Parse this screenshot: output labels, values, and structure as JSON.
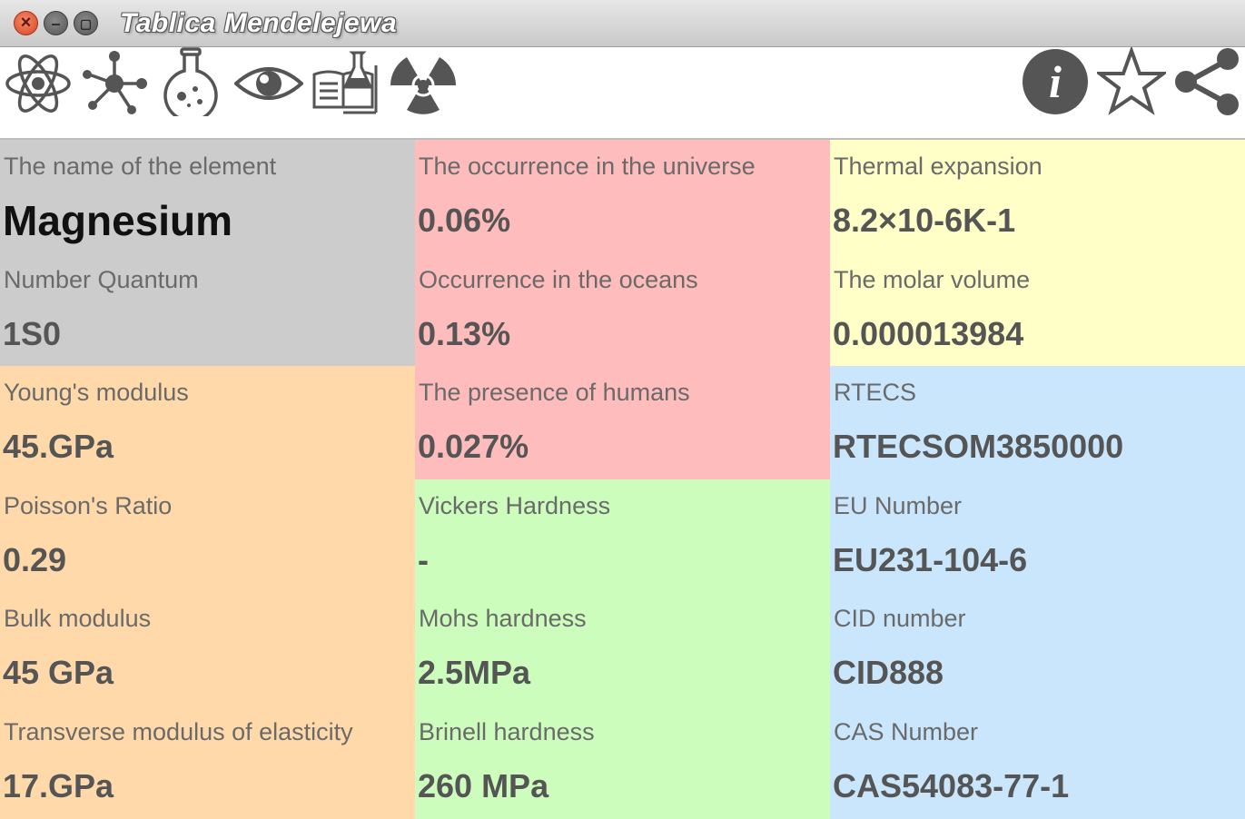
{
  "window": {
    "title": "Tablica Mendelejewa",
    "close_glyph": "×",
    "minimize_glyph": "–",
    "maximize_glyph": "▢"
  },
  "toolbar": {
    "left_icons": [
      "atom-icon",
      "molecule-icon",
      "flask-icon",
      "eye-icon",
      "book-flask-icon",
      "radiation-icon"
    ],
    "right_icons": [
      "info-icon",
      "star-icon",
      "share-icon"
    ],
    "info_glyph": "i"
  },
  "colors": {
    "gray": "#cccccc",
    "orange": "#ffd9aa",
    "pink": "#ffbcbc",
    "green": "#ccfdbd",
    "yellow": "#ffffc7",
    "blue": "#c9e6fc"
  },
  "columns": [
    {
      "cells": [
        {
          "label": "The name of the element",
          "value": "Magnesium",
          "color": "#cccccc"
        },
        {
          "label": "Number Quantum",
          "value": "1S0",
          "color": "#cccccc"
        },
        {
          "label": "Young's modulus",
          "value": "45.GPa",
          "color": "#ffd9aa"
        },
        {
          "label": "Poisson's Ratio",
          "value": "0.29",
          "color": "#ffd9aa"
        },
        {
          "label": "Bulk modulus",
          "value": "45 GPa",
          "color": "#ffd9aa"
        },
        {
          "label": "Transverse modulus of elasticity",
          "value": "17.GPa",
          "color": "#ffd9aa"
        }
      ]
    },
    {
      "cells": [
        {
          "label": "The occurrence in the universe",
          "value": "0.06%",
          "color": "#ffbcbc"
        },
        {
          "label": "Occurrence in the oceans",
          "value": "0.13%",
          "color": "#ffbcbc"
        },
        {
          "label": "The presence of humans",
          "value": "0.027%",
          "color": "#ffbcbc"
        },
        {
          "label": "Vickers Hardness",
          "value": "-",
          "color": "#ccfdbd"
        },
        {
          "label": "Mohs hardness",
          "value": "2.5MPa",
          "color": "#ccfdbd"
        },
        {
          "label": "Brinell hardness",
          "value": "260 MPa",
          "color": "#ccfdbd"
        }
      ]
    },
    {
      "cells": [
        {
          "label": "Thermal expansion",
          "value": "8.2×10-6K-1",
          "color": "#ffffc7"
        },
        {
          "label": "The molar volume",
          "value": "0.000013984",
          "color": "#ffffc7"
        },
        {
          "label": "RTECS",
          "value": "RTECSOM3850000",
          "color": "#c9e6fc"
        },
        {
          "label": "EU Number",
          "value": "EU231-104-6",
          "color": "#c9e6fc"
        },
        {
          "label": "CID number",
          "value": "CID888",
          "color": "#c9e6fc"
        },
        {
          "label": "CAS Number",
          "value": "CAS54083-77-1",
          "color": "#c9e6fc"
        }
      ]
    }
  ]
}
